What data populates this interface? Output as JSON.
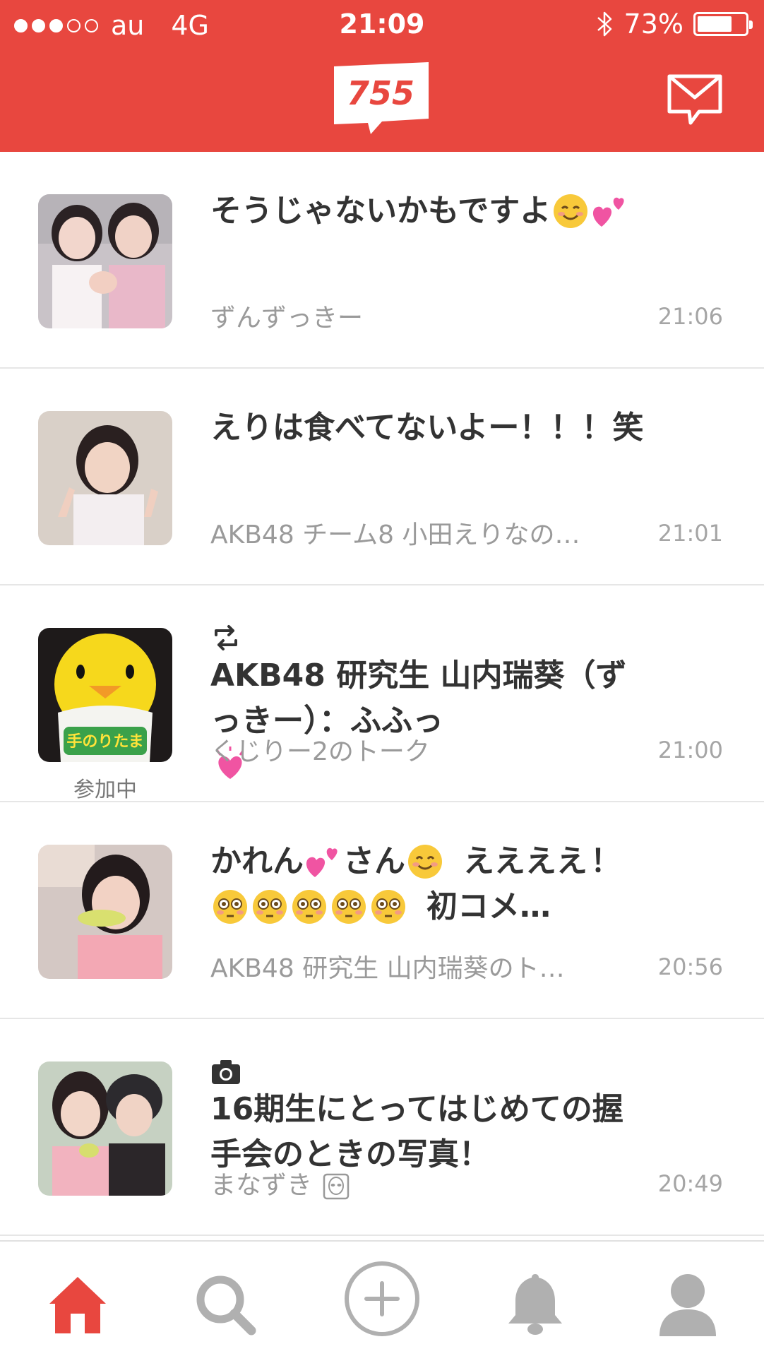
{
  "status_bar": {
    "carrier": "au",
    "network": "4G",
    "time": "21:09",
    "battery_percent": "73%",
    "battery_level": 0.73
  },
  "header": {
    "logo_text": "755",
    "accent_color": "#e8473f"
  },
  "feed": [
    {
      "title": "そうじゃないかもですよ",
      "subtitle": "ずんずっきー",
      "time": "21:06"
    },
    {
      "title": "えりは食べてないよー！！！笑",
      "subtitle": "AKB48 チーム8 小田えりなの…",
      "time": "21:01"
    },
    {
      "title": "AKB48 研究生 山内瑞葵（ずっきー）：ふふっ",
      "subtitle": "くじりー2のトーク",
      "time": "21:00",
      "badge": "参加中",
      "thumb_label": "手のりたま"
    },
    {
      "title_part1": "かれん",
      "title_part2": "さん",
      "title_part3": "ええええ",
      "title_part4": "！",
      "title_part5": "初コメ…",
      "subtitle": "AKB48 研究生 山内瑞葵のト…",
      "time": "20:56"
    },
    {
      "title": "16期生にとってはじめての握手会のときの写真！",
      "subtitle": "まなずき",
      "time": "20:49"
    }
  ],
  "tabs": [
    "home",
    "search",
    "post",
    "notifications",
    "profile"
  ]
}
